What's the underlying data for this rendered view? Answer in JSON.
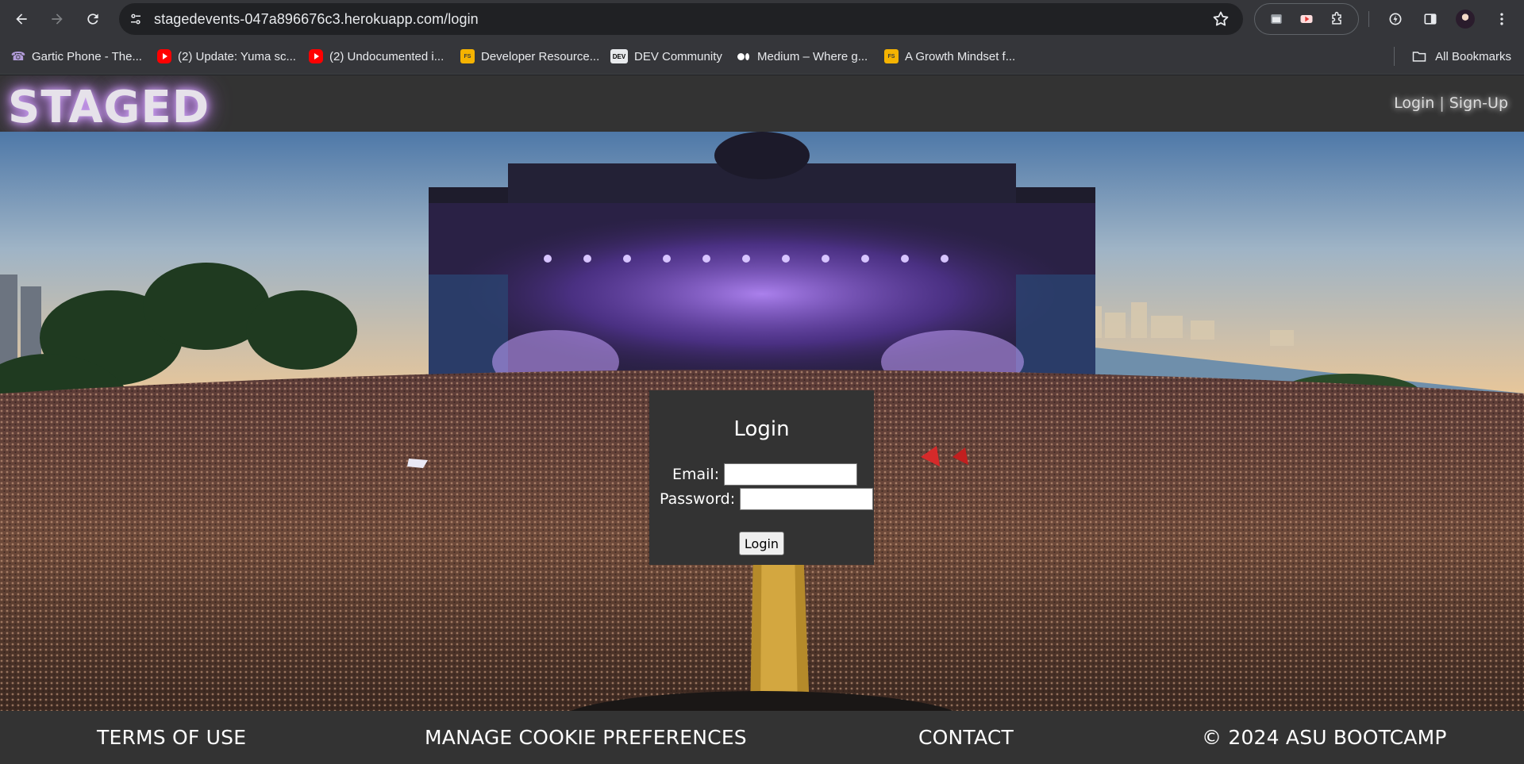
{
  "browser": {
    "url": "stagedevents-047a896676c3.herokuapp.com/login",
    "icons": {
      "back": "arrow-left-icon",
      "forward": "arrow-right-icon",
      "reload": "reload-icon",
      "site_info": "tune-icon",
      "bookmark_star": "star-icon"
    },
    "bookmarks": [
      {
        "label": "Gartic Phone - The...",
        "icon": "phone-icon"
      },
      {
        "label": "(2) Update: Yuma sc...",
        "icon": "youtube-icon"
      },
      {
        "label": "(2) Undocumented i...",
        "icon": "youtube-icon"
      },
      {
        "label": "Developer Resource...",
        "icon": "fs-icon",
        "icon_text": "FS"
      },
      {
        "label": "DEV Community",
        "icon": "dev-icon",
        "icon_text": "DEV"
      },
      {
        "label": "Medium – Where g...",
        "icon": "medium-icon"
      },
      {
        "label": "A Growth Mindset f...",
        "icon": "fs-icon",
        "icon_text": "FS"
      }
    ],
    "all_bookmarks": "All Bookmarks"
  },
  "site": {
    "logo": "STAGED",
    "nav": {
      "login": "Login",
      "separator": "|",
      "signup": "Sign-Up"
    }
  },
  "login_form": {
    "title": "Login",
    "email_label": "Email:",
    "email_value": "",
    "password_label": "Password:",
    "password_value": "",
    "submit_label": "Login"
  },
  "footer": {
    "terms": "TERMS OF USE",
    "cookies": "MANAGE COOKIE PREFERENCES",
    "contact": "CONTACT",
    "copyright": "© 2024 ASU BOOTCAMP"
  },
  "colors": {
    "header_bg": "#333333",
    "logo_glow": "#b07bd6",
    "stage_light": "#8a4fff"
  }
}
